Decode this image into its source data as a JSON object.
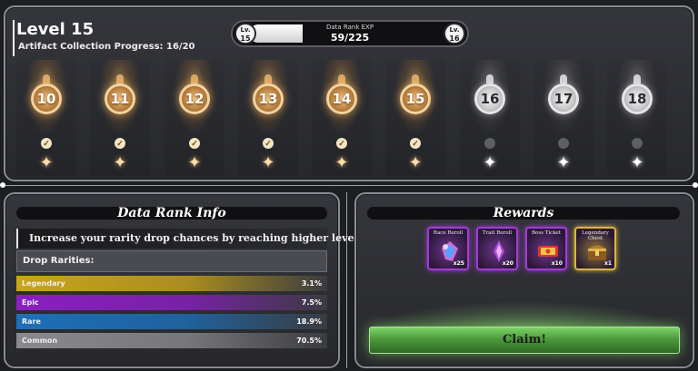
{
  "header": {
    "level_title": "Level 15",
    "progress_label": "Artifact Collection Progress: 16/20"
  },
  "exp_bar": {
    "label": "Data Rank EXP",
    "value": "59/225",
    "fraction": 0.262,
    "left_badge": {
      "prefix": "Lv.",
      "level": "15"
    },
    "right_badge": {
      "prefix": "Lv.",
      "level": "16"
    }
  },
  "levels": [
    {
      "number": "10",
      "status": "unlocked",
      "check": "✓"
    },
    {
      "number": "11",
      "status": "unlocked",
      "check": "✓"
    },
    {
      "number": "12",
      "status": "unlocked",
      "check": "✓"
    },
    {
      "number": "13",
      "status": "unlocked",
      "check": "✓"
    },
    {
      "number": "14",
      "status": "unlocked",
      "check": "✓"
    },
    {
      "number": "15",
      "status": "unlocked",
      "check": "✓"
    },
    {
      "number": "16",
      "status": "locked",
      "check": ""
    },
    {
      "number": "17",
      "status": "locked",
      "check": ""
    },
    {
      "number": "18",
      "status": "locked",
      "check": ""
    }
  ],
  "info": {
    "title": "Data Rank Info",
    "description": "Increase your rarity drop chances by reaching higher levels!",
    "drop_title": "Drop Rarities:",
    "rarities": [
      {
        "name": "Legendary",
        "value": "3.1%",
        "color": "#c9a51a"
      },
      {
        "name": "Epic",
        "value": "7.5%",
        "color": "#8a1fc2"
      },
      {
        "name": "Rare",
        "value": "18.9%",
        "color": "#1d6fb8"
      },
      {
        "name": "Common",
        "value": "70.5%",
        "color": "#8a8a8e"
      }
    ]
  },
  "rewards": {
    "title": "Rewards",
    "items": [
      {
        "label": "Race Reroll",
        "qty": "x25",
        "icon": "race-reroll-icon",
        "frame": "#a43bd6"
      },
      {
        "label": "Trait Reroll",
        "qty": "x20",
        "icon": "trait-reroll-icon",
        "frame": "#a43bd6"
      },
      {
        "label": "Boss Ticket",
        "qty": "x10",
        "icon": "boss-ticket-icon",
        "frame": "#a43bd6"
      },
      {
        "label": "Legendary Chest",
        "qty": "x1",
        "icon": "legendary-chest-icon",
        "frame": "#d9b63a"
      }
    ],
    "claim_label": "Claim!"
  }
}
